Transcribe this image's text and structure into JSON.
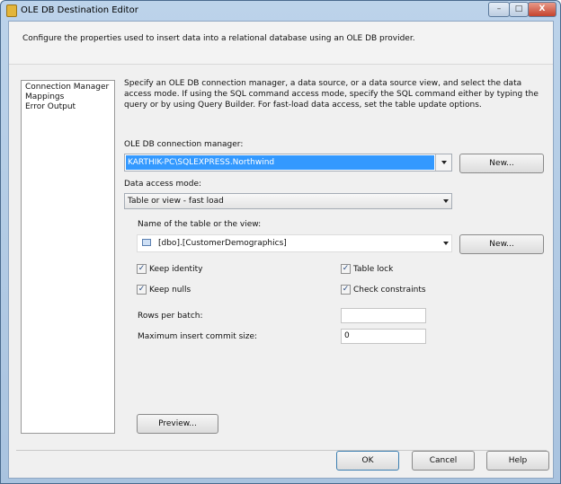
{
  "window": {
    "title": "OLE DB Destination Editor",
    "minimize": "–",
    "maximize": "□",
    "close": "X"
  },
  "header": {
    "description": "Configure the properties used to insert data into a relational database using an OLE DB provider."
  },
  "nav": {
    "items": [
      "Connection Manager",
      "Mappings",
      "Error Output"
    ]
  },
  "main": {
    "instructions": "Specify an OLE DB connection manager, a data source, or a data source view, and select the data access mode. If using the SQL command access mode, specify the SQL command either by typing the query or by using Query Builder. For fast-load data access, set the table update options.",
    "connection_label": "OLE DB connection manager:",
    "connection_value": "KARTHIK-PC\\SQLEXPRESS.Northwind",
    "new_label": "New...",
    "access_mode_label": "Data access mode:",
    "access_mode_value": "Table or view - fast load",
    "table_label": "Name of the table or the view:",
    "table_value": "[dbo].[CustomerDemographics]",
    "keep_identity": {
      "label": "Keep identity",
      "checked": true
    },
    "keep_nulls": {
      "label": "Keep nulls",
      "checked": true
    },
    "table_lock": {
      "label": "Table lock",
      "checked": true
    },
    "check_constraints": {
      "label": "Check constraints",
      "checked": true
    },
    "rows_per_batch_label": "Rows per batch:",
    "rows_per_batch_value": "",
    "max_commit_label": "Maximum insert commit size:",
    "max_commit_value": "0",
    "preview_label": "Preview..."
  },
  "footer": {
    "ok": "OK",
    "cancel": "Cancel",
    "help": "Help"
  },
  "colors": {
    "selection": "#3399ff"
  }
}
